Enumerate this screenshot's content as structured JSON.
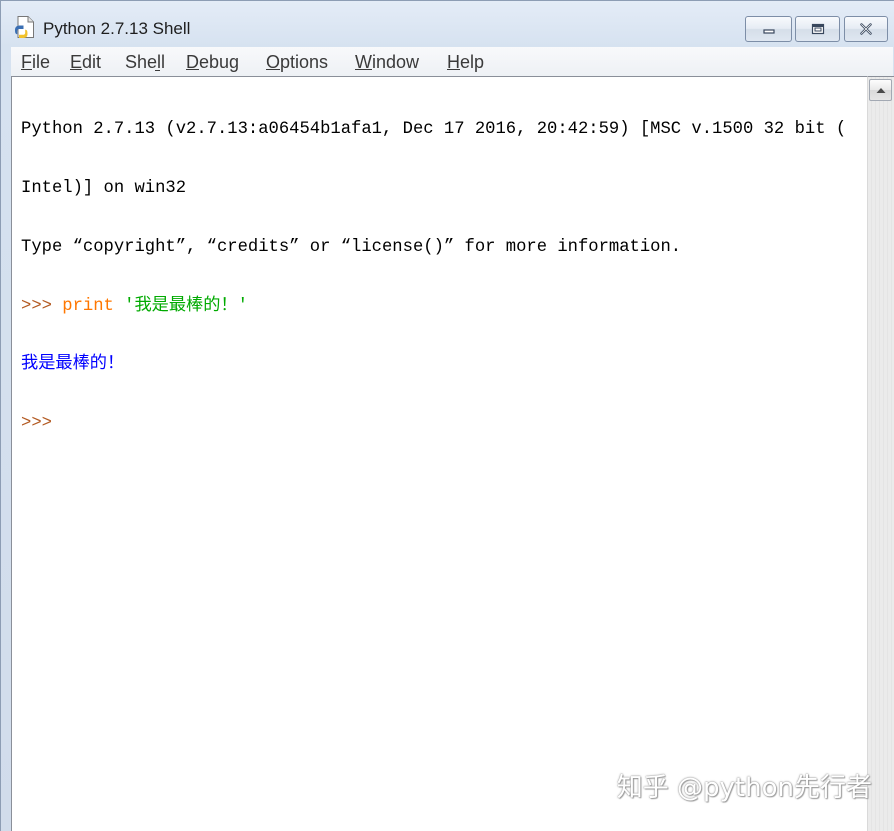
{
  "window": {
    "title": "Python 2.7.13 Shell"
  },
  "menu": {
    "items": [
      {
        "label": "File"
      },
      {
        "label": "Edit"
      },
      {
        "label": "Shell"
      },
      {
        "label": "Debug"
      },
      {
        "label": "Options"
      },
      {
        "label": "Window"
      },
      {
        "label": "Help"
      }
    ]
  },
  "shell": {
    "banner": [
      "Python 2.7.13 (v2.7.13:a06454b1afa1, Dec 17 2016, 20:42:59) [MSC v.1500 32 bit (",
      "Intel)] on win32",
      "Type “copyright”, “credits” or “license()” for more information."
    ],
    "input_line": {
      "prompt": ">>> ",
      "keyword": "print",
      "string": "'我是最棒的！'"
    },
    "output": "我是最棒的！",
    "current_prompt": ">>>"
  },
  "watermark": "知乎 @python先行者",
  "colors": {
    "text": "#000000",
    "prompt": "#b35a22",
    "keyword": "#ff7700",
    "string": "#00aa00",
    "stdout": "#0000ff"
  },
  "icons": {
    "window_icon": "python-file-icon",
    "minimize": "minimize-icon",
    "maximize": "maximize-icon",
    "close": "close-icon",
    "scroll_up": "arrow-up-icon"
  }
}
